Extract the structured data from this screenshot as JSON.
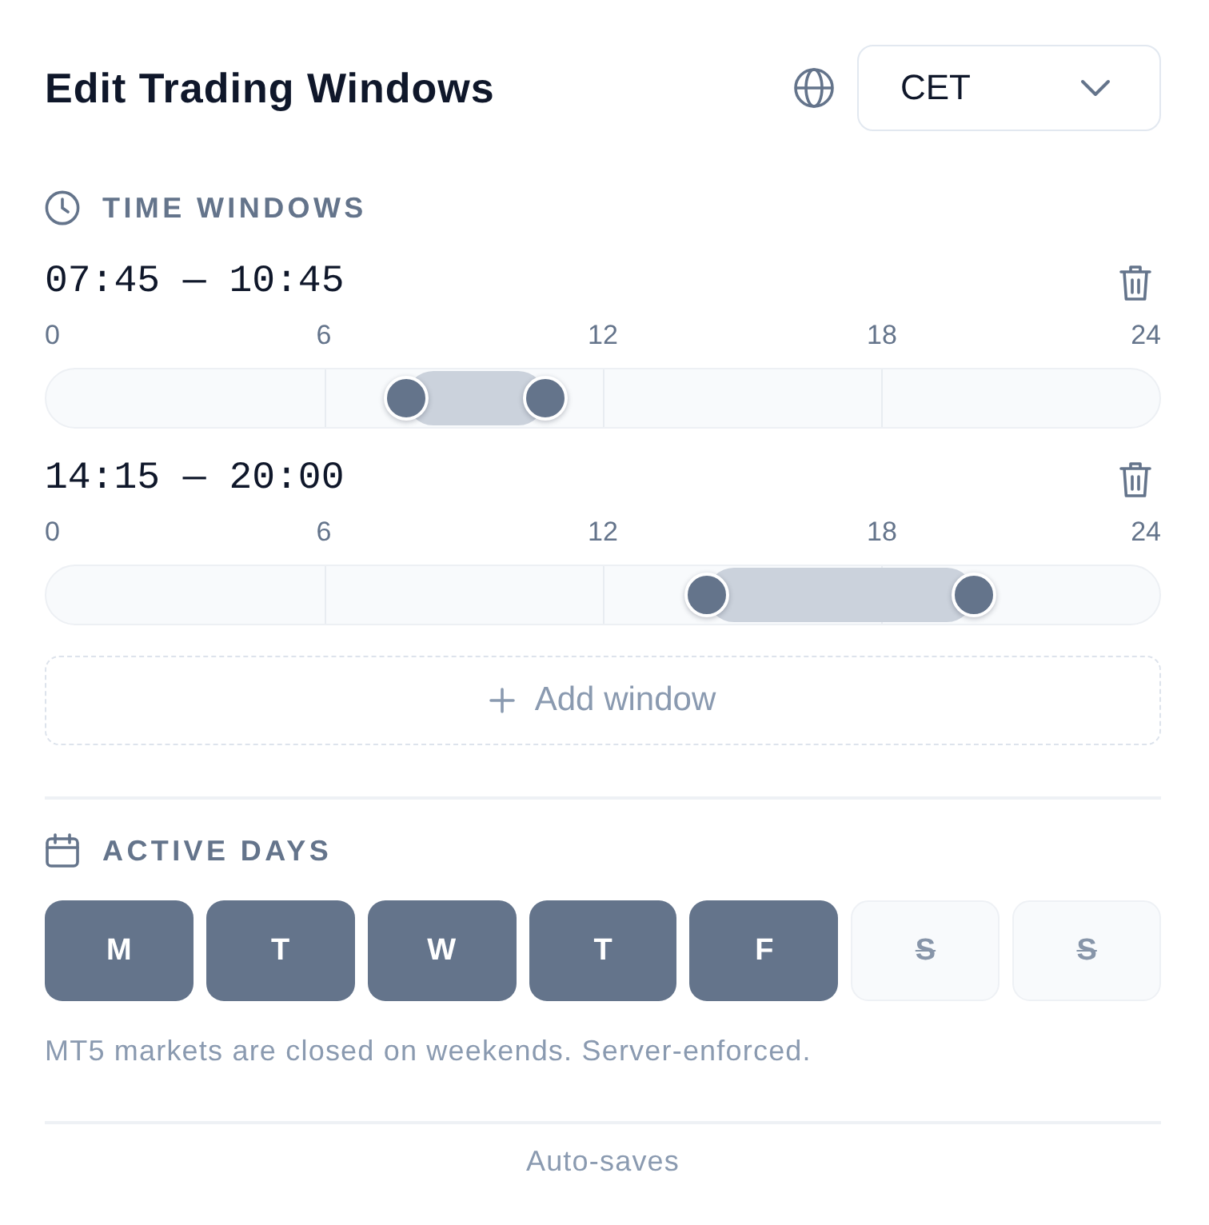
{
  "header": {
    "title": "Edit Trading Windows",
    "timezone": {
      "value": "CET"
    }
  },
  "time_windows": {
    "heading": "TIME WINDOWS",
    "windows": [
      {
        "label": "07:45 — 10:45",
        "scale": [
          "0",
          "6",
          "12",
          "18",
          "24"
        ],
        "handles": [
          {
            "level": 0.3229
          },
          {
            "level": 0.4479
          }
        ]
      },
      {
        "label": "14:15 — 20:00",
        "scale": [
          "0",
          "6",
          "12",
          "18",
          "24"
        ],
        "handles": [
          {
            "level": 0.5938
          },
          {
            "level": 0.8333
          }
        ]
      }
    ],
    "add_button": {
      "label": "Add window"
    }
  },
  "active_days": {
    "heading": "ACTIVE DAYS",
    "days": [
      {
        "label": "M",
        "selected": true,
        "disabled": false
      },
      {
        "label": "T",
        "selected": true,
        "disabled": false
      },
      {
        "label": "W",
        "selected": true,
        "disabled": false
      },
      {
        "label": "T",
        "selected": true,
        "disabled": false
      },
      {
        "label": "F",
        "selected": true,
        "disabled": false
      },
      {
        "label": "S",
        "selected": false,
        "disabled": true
      },
      {
        "label": "S",
        "selected": false,
        "disabled": true
      }
    ],
    "note": "MT5 markets are closed on weekends. Server-enforced."
  },
  "footer": {
    "status": "Auto-saves"
  }
}
